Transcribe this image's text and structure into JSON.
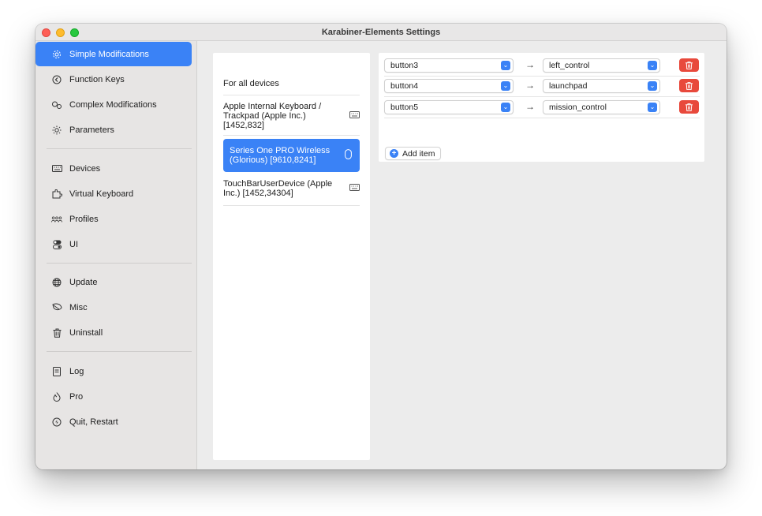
{
  "window": {
    "title": "Karabiner-Elements Settings"
  },
  "sidebar": {
    "items": [
      {
        "label": "Simple Modifications",
        "icon": "gear-icon",
        "active": true
      },
      {
        "label": "Function Keys",
        "icon": "function-key-icon"
      },
      {
        "label": "Complex Modifications",
        "icon": "gears-icon"
      },
      {
        "label": "Parameters",
        "icon": "sun-icon"
      },
      {
        "label": "Devices",
        "icon": "keyboard-icon"
      },
      {
        "label": "Virtual Keyboard",
        "icon": "puzzle-icon"
      },
      {
        "label": "Profiles",
        "icon": "people-icon"
      },
      {
        "label": "UI",
        "icon": "toggles-icon"
      },
      {
        "label": "Update",
        "icon": "globe-icon"
      },
      {
        "label": "Misc",
        "icon": "leaf-icon"
      },
      {
        "label": "Uninstall",
        "icon": "trash-icon"
      },
      {
        "label": "Log",
        "icon": "document-icon"
      },
      {
        "label": "Pro",
        "icon": "flame-icon"
      },
      {
        "label": "Quit, Restart",
        "icon": "power-icon"
      }
    ]
  },
  "devices": {
    "items": [
      {
        "label": "For all devices",
        "icon": ""
      },
      {
        "label": "Apple Internal Keyboard / Trackpad (Apple Inc.) [1452,832]",
        "icon": "keyboard-icon"
      },
      {
        "label": "Series One PRO Wireless (Glorious) [9610,8241]",
        "icon": "mouse-icon",
        "selected": true
      },
      {
        "label": "TouchBarUserDevice (Apple Inc.) [1452,34304]",
        "icon": "keyboard-icon"
      }
    ]
  },
  "modifications": {
    "rows": [
      {
        "from": "button3",
        "to": "left_control"
      },
      {
        "from": "button4",
        "to": "launchpad"
      },
      {
        "from": "button5",
        "to": "mission_control"
      }
    ],
    "arrow": "→",
    "add_label": "Add item"
  },
  "colors": {
    "accent": "#3a82f6",
    "danger": "#e8493c"
  }
}
